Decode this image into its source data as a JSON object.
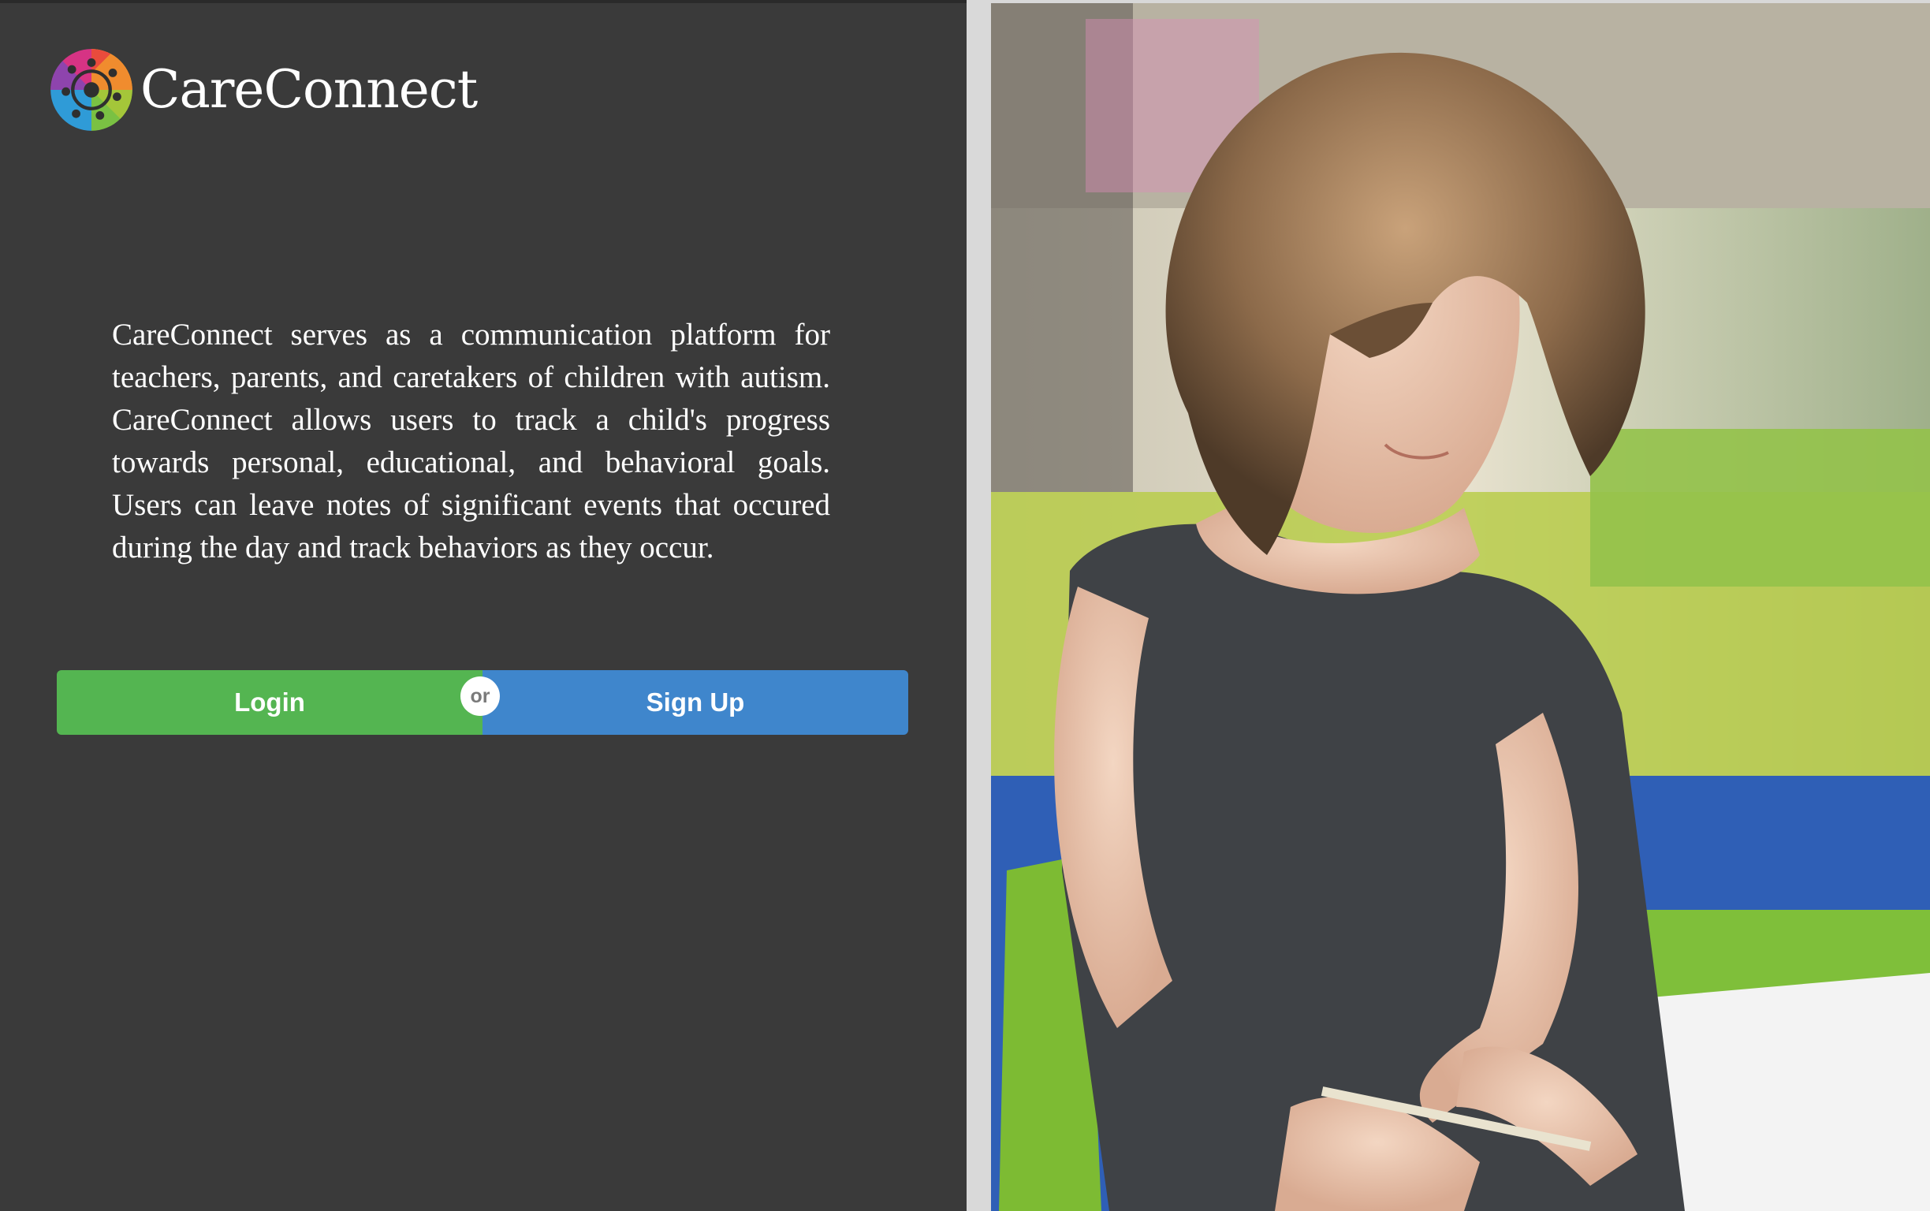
{
  "brand": {
    "name": "CareConnect",
    "logo_colors": [
      "#e94b3c",
      "#f5a623",
      "#7ac143",
      "#2f9bd7",
      "#8e44ad",
      "#d63384"
    ]
  },
  "intro": {
    "text": "CareConnect serves as a communication platform for teachers, parents, and caretakers of children with autism. CareConnect allows users to track a child's progress towards personal, educational, and behavioral goals. Users can leave notes of significant events that occured during the day and track behaviors as they occur."
  },
  "actions": {
    "login_label": "Login",
    "separator_label": "or",
    "signup_label": "Sign Up"
  },
  "colors": {
    "panel_background": "#3a3a3a",
    "login_button": "#54b551",
    "signup_button": "#3f86cc"
  },
  "hero_image": {
    "icon": "photo-child-writing-icon"
  }
}
